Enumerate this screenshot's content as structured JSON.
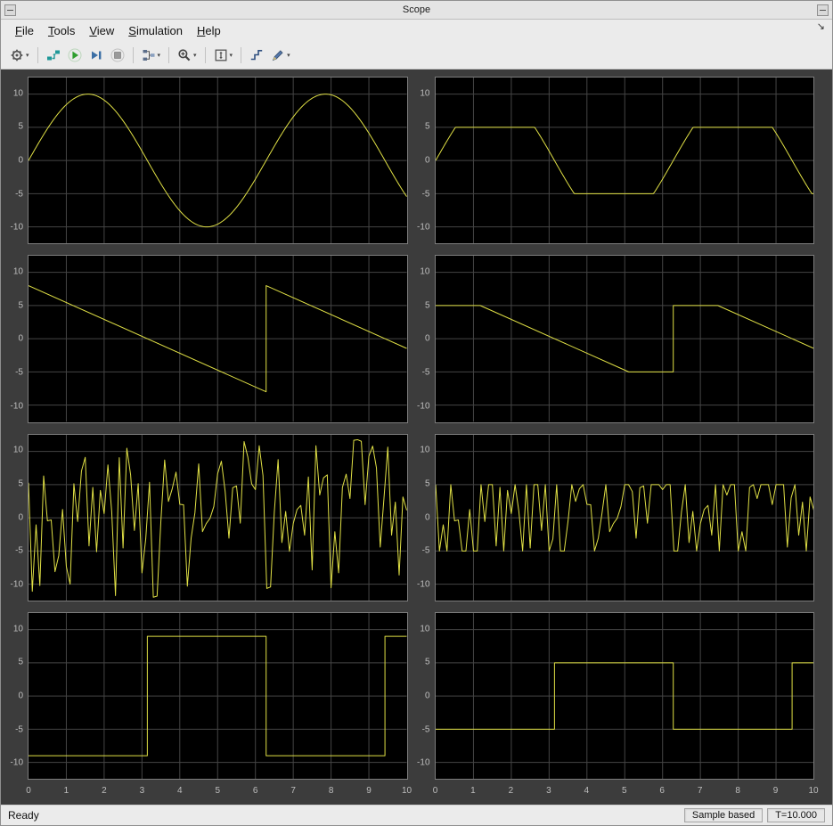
{
  "window": {
    "title": "Scope"
  },
  "menu": {
    "items": [
      "File",
      "Tools",
      "View",
      "Simulation",
      "Help"
    ],
    "dock_glyph": "↘"
  },
  "toolbar": {
    "caret": "▾",
    "icons": [
      "settings-gear",
      "simulink-diagram",
      "run",
      "step-forward",
      "stop",
      "signal-selector",
      "zoom",
      "autoscale",
      "trigger",
      "measurements"
    ]
  },
  "statusbar": {
    "ready": "Ready",
    "sample_mode": "Sample based",
    "sim_time": "T=10.000"
  },
  "chart_meta": {
    "xlim": [
      0,
      10
    ],
    "ylim": [
      -12.5,
      12.5
    ],
    "xticks": [
      0,
      1,
      2,
      3,
      4,
      5,
      6,
      7,
      8,
      9,
      10
    ],
    "yticks": [
      10,
      5,
      0,
      -5,
      -10
    ],
    "line_color": "#e0e045",
    "grid_color": "#454545",
    "panel_bg": "#000000",
    "canvas_bg": "#3c3c3c",
    "tick_label_color": "#bdbdbd",
    "grid_on": true,
    "legend": "none"
  },
  "chart_data": [
    {
      "id": "sine",
      "type": "line",
      "row": 1,
      "col": 1,
      "signal": {
        "kind": "sine",
        "amplitude": 10,
        "period": 6.2832,
        "phase": 0
      }
    },
    {
      "id": "saturated-sine",
      "type": "line",
      "row": 1,
      "col": 2,
      "signal": {
        "kind": "sine",
        "amplitude": 10,
        "period": 6.2832,
        "phase": 0,
        "clip": 5
      }
    },
    {
      "id": "sawtooth",
      "type": "line",
      "row": 2,
      "col": 1,
      "signal": {
        "kind": "points",
        "points": [
          [
            0,
            8
          ],
          [
            6.283,
            -8
          ],
          [
            6.2831,
            8
          ],
          [
            10,
            -1.46
          ]
        ]
      }
    },
    {
      "id": "saturated-sawtooth",
      "type": "line",
      "row": 2,
      "col": 2,
      "signal": {
        "kind": "points",
        "points": [
          [
            0,
            5
          ],
          [
            1.178,
            5
          ],
          [
            5.106,
            -5
          ],
          [
            6.283,
            -5
          ],
          [
            6.2831,
            5
          ],
          [
            7.461,
            5
          ],
          [
            10,
            -1.46
          ]
        ]
      }
    },
    {
      "id": "random-noise",
      "type": "line",
      "row": 3,
      "col": 1,
      "signal": {
        "kind": "noise",
        "amplitude": 12,
        "dt": 0.1,
        "seed": 3
      }
    },
    {
      "id": "saturated-noise",
      "type": "line",
      "row": 3,
      "col": 2,
      "signal": {
        "kind": "noise",
        "amplitude": 12,
        "dt": 0.1,
        "seed": 3,
        "clip": 5
      }
    },
    {
      "id": "square",
      "type": "line",
      "row": 4,
      "col": 1,
      "signal": {
        "kind": "points",
        "points": [
          [
            0,
            -9
          ],
          [
            3.1416,
            -9
          ],
          [
            3.1416,
            9
          ],
          [
            6.2832,
            9
          ],
          [
            6.2832,
            -9
          ],
          [
            9.4248,
            -9
          ],
          [
            9.4248,
            9
          ],
          [
            10,
            9
          ]
        ]
      }
    },
    {
      "id": "saturated-square",
      "type": "line",
      "row": 4,
      "col": 2,
      "signal": {
        "kind": "points",
        "points": [
          [
            0,
            -5
          ],
          [
            3.1416,
            -5
          ],
          [
            3.1416,
            5
          ],
          [
            6.2832,
            5
          ],
          [
            6.2832,
            -5
          ],
          [
            9.4248,
            -5
          ],
          [
            9.4248,
            5
          ],
          [
            10,
            5
          ]
        ]
      }
    }
  ]
}
